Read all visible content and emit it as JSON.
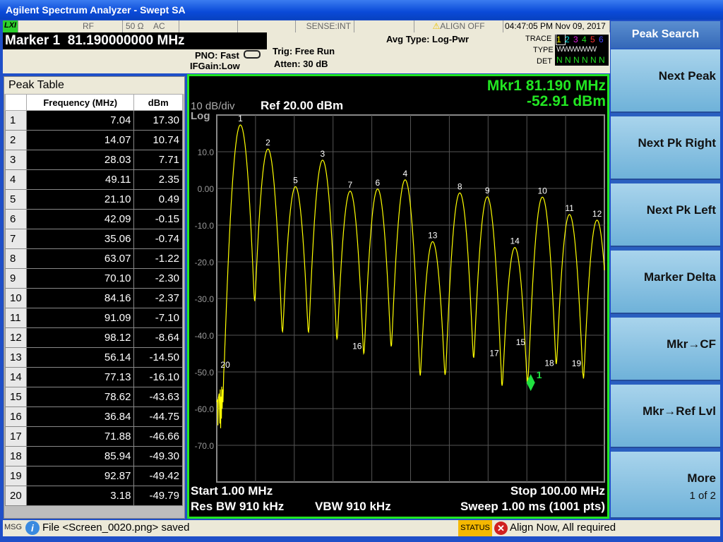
{
  "window": {
    "title": "Agilent Spectrum Analyzer - Swept SA"
  },
  "status": {
    "lxi": "LXI",
    "rf": "RF",
    "impedance": "50 Ω",
    "coupling": "AC",
    "sense": "SENSE:INT",
    "align": "ALIGN OFF",
    "datetime": "04:47:05 PM Nov 09, 2017"
  },
  "marker_header": "Marker 1  81.190000000 MHz",
  "settings": {
    "pno": "PNO: Fast",
    "ifgain": "IFGain:Low",
    "trig": "Trig: Free Run",
    "atten": "Atten: 30 dB",
    "avg": "Avg Type: Log-Pwr"
  },
  "trace_panel": {
    "trace_label": "TRACE",
    "type_label": "TYPE",
    "det_label": "DET",
    "traces": [
      "1",
      "2",
      "3",
      "4",
      "5",
      "6"
    ],
    "trace_colors": [
      "#ffff00",
      "#00e0e0",
      "#e020e0",
      "#20e020",
      "#ff3030",
      "#4040ff"
    ],
    "type": "WWWWWW",
    "det": [
      "N",
      "N",
      "N",
      "N",
      "N",
      "N"
    ]
  },
  "peak_table": {
    "title": "Peak Table",
    "columns": [
      "",
      "Frequency (MHz)",
      "dBm"
    ],
    "rows": [
      [
        "1",
        "7.04",
        "17.30"
      ],
      [
        "2",
        "14.07",
        "10.74"
      ],
      [
        "3",
        "28.03",
        "7.71"
      ],
      [
        "4",
        "49.11",
        "2.35"
      ],
      [
        "5",
        "21.10",
        "0.49"
      ],
      [
        "6",
        "42.09",
        "-0.15"
      ],
      [
        "7",
        "35.06",
        "-0.74"
      ],
      [
        "8",
        "63.07",
        "-1.22"
      ],
      [
        "9",
        "70.10",
        "-2.30"
      ],
      [
        "10",
        "84.16",
        "-2.37"
      ],
      [
        "11",
        "91.09",
        "-7.10"
      ],
      [
        "12",
        "98.12",
        "-8.64"
      ],
      [
        "13",
        "56.14",
        "-14.50"
      ],
      [
        "14",
        "77.13",
        "-16.10"
      ],
      [
        "15",
        "78.62",
        "-43.63"
      ],
      [
        "16",
        "36.84",
        "-44.75"
      ],
      [
        "17",
        "71.88",
        "-46.66"
      ],
      [
        "18",
        "85.94",
        "-49.30"
      ],
      [
        "19",
        "92.87",
        "-49.42"
      ],
      [
        "20",
        "3.18",
        "-49.79"
      ]
    ]
  },
  "plot": {
    "scale": "10 dB/div",
    "log": "Log",
    "ref": "Ref 20.00 dBm",
    "mkr_freq": "Mkr1 81.190 MHz",
    "mkr_amp": "-52.91 dBm",
    "marker_label": "1",
    "y_ticks": [
      "10.0",
      "0.00",
      "-10.0",
      "-20.0",
      "-30.0",
      "-40.0",
      "-50.0",
      "-60.0",
      "-70.0"
    ],
    "start": "Start 1.00 MHz",
    "stop": "Stop 100.00 MHz",
    "rbw": "Res BW 910 kHz",
    "vbw": "VBW 910 kHz",
    "sweep": "Sweep  1.00 ms (1001 pts)",
    "trace_color": "#ffff00",
    "marker_color": "#20e040"
  },
  "chart_data": {
    "type": "line",
    "x_range_mhz": [
      1,
      100
    ],
    "y_range_dbm": [
      -80,
      20
    ],
    "ref_level_dbm": 20,
    "db_per_div": 10,
    "grid": true,
    "marker": {
      "freq_mhz": 81.19,
      "amp_dbm": -52.91
    }
  },
  "softkeys": {
    "title": "Peak Search",
    "keys": [
      "Next Peak",
      "Next Pk Right",
      "Next Pk Left",
      "Marker Delta",
      "Mkr→CF",
      "Mkr→Ref Lvl",
      "More"
    ],
    "more_sub": "1 of 2"
  },
  "message": {
    "msg_label": "MSG",
    "text": "File <Screen_0020.png> saved",
    "status_label": "STATUS",
    "status_text": "Align Now, All required"
  }
}
